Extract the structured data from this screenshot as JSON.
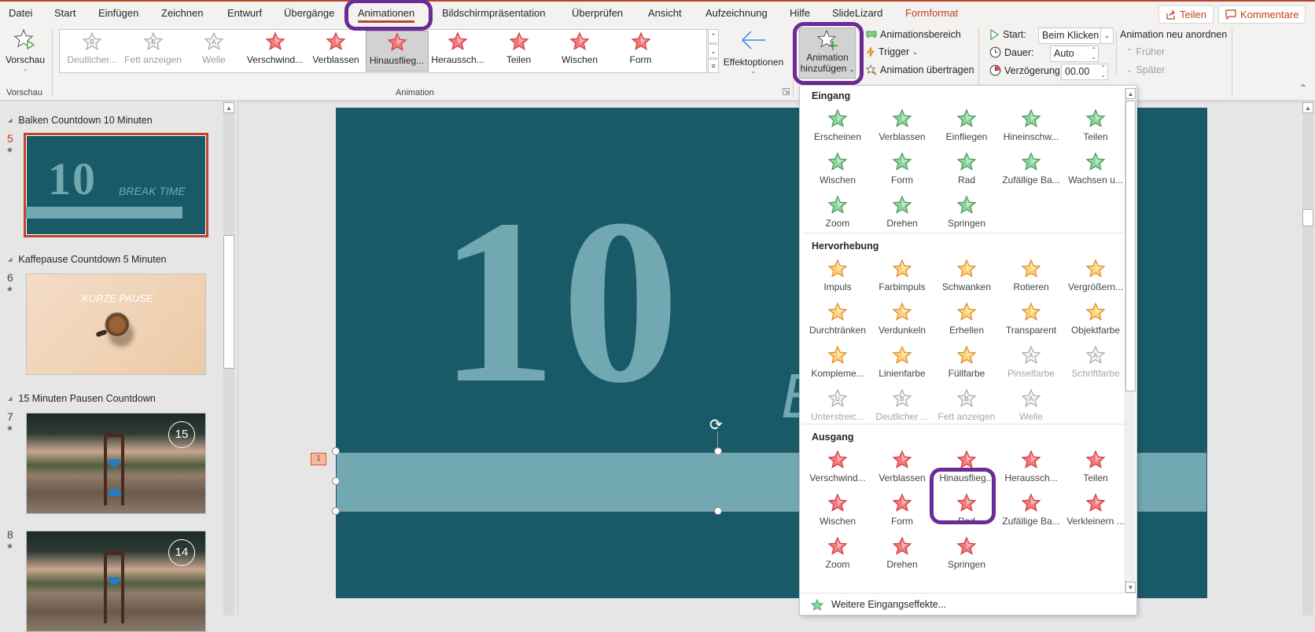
{
  "menu": {
    "tabs": [
      {
        "label": "Datei"
      },
      {
        "label": "Start"
      },
      {
        "label": "Einfügen"
      },
      {
        "label": "Zeichnen"
      },
      {
        "label": "Entwurf"
      },
      {
        "label": "Übergänge"
      },
      {
        "label": "Animationen",
        "active": true
      },
      {
        "label": "Bildschirmpräsentation"
      },
      {
        "label": "Überprüfen"
      },
      {
        "label": "Ansicht"
      },
      {
        "label": "Aufzeichnung"
      },
      {
        "label": "Hilfe"
      },
      {
        "label": "SlideLizard"
      },
      {
        "label": "Formformat",
        "contextual": true
      }
    ],
    "share_label": "Teilen",
    "comments_label": "Kommentare"
  },
  "ribbon": {
    "preview": {
      "button_label": "Vorschau",
      "group_label": "Vorschau"
    },
    "animation_group_label": "Animation",
    "gallery": [
      {
        "label": "Deutlicher...",
        "category": "emphasis",
        "disabled": true,
        "glyph": "B"
      },
      {
        "label": "Fett anzeigen",
        "category": "emphasis",
        "disabled": true,
        "glyph": "B"
      },
      {
        "label": "Welle",
        "category": "emphasis",
        "disabled": true,
        "glyph": "A"
      },
      {
        "label": "Verschwind...",
        "category": "exit"
      },
      {
        "label": "Verblassen",
        "category": "exit"
      },
      {
        "label": "Hinausflieg...",
        "category": "exit",
        "selected": true
      },
      {
        "label": "Heraussch...",
        "category": "exit"
      },
      {
        "label": "Teilen",
        "category": "exit"
      },
      {
        "label": "Wischen",
        "category": "exit"
      },
      {
        "label": "Form",
        "category": "exit"
      }
    ],
    "effect_options_label": "Effektoptionen",
    "add_animation": {
      "line1": "Animation",
      "line2": "hinzufügen"
    },
    "advanced": {
      "pane_label": "Animationsbereich",
      "trigger_label": "Trigger",
      "painter_label": "Animation übertragen"
    },
    "timing": {
      "start_label": "Start:",
      "start_value": "Beim Klicken",
      "duration_label": "Dauer:",
      "duration_value": "Auto",
      "delay_label": "Verzögerung:",
      "delay_value": "00.00"
    },
    "reorder": {
      "title": "Animation neu anordnen",
      "earlier_label": "Früher",
      "later_label": "Später"
    }
  },
  "thumbnails": {
    "sections": [
      {
        "title": "Balken Countdown 10 Minuten"
      },
      {
        "title": "Kaffepause Countdown 5 Minuten"
      },
      {
        "title": "15 Minuten Pausen Countdown"
      }
    ],
    "slides": [
      {
        "number": "5",
        "active": true,
        "big_text": "10",
        "caption": "BREAK TIME"
      },
      {
        "number": "6",
        "caption": "KURZE PAUSE"
      },
      {
        "number": "7",
        "badge": "15"
      },
      {
        "number": "8",
        "badge": "14"
      }
    ]
  },
  "slide": {
    "big_number": "10",
    "partial_text": "B",
    "animation_tag": "1",
    "colors": {
      "background": "#195a68",
      "accent": "#72a8b2"
    }
  },
  "dropdown": {
    "sections": [
      {
        "title": "Eingang",
        "color": "green",
        "items": [
          "Erscheinen",
          "Verblassen",
          "Einfliegen",
          "Hineinschw...",
          "Teilen",
          "Wischen",
          "Form",
          "Rad",
          "Zufällige Ba...",
          "Wachsen u...",
          "Zoom",
          "Drehen",
          "Springen"
        ]
      },
      {
        "title": "Hervorhebung",
        "color": "orange",
        "items": [
          "Impuls",
          "Farbimpuls",
          "Schwanken",
          "Rotieren",
          "Vergrößern...",
          "Durchtränken",
          "Verdunkeln",
          "Erhellen",
          "Transparent",
          "Objektfarbe",
          "Kompleme...",
          "Linienfarbe",
          "Füllfarbe",
          "Pinselfarbe",
          "Schriftfarbe",
          "Unterstreic...",
          "Deutlicher ...",
          "Fett anzeigen",
          "Welle"
        ],
        "disabled_from": 13
      },
      {
        "title": "Ausgang",
        "color": "red",
        "items": [
          "Verschwind...",
          "Verblassen",
          "Hinausflieg...",
          "Heraussch...",
          "Teilen",
          "Wischen",
          "Form",
          "Rad",
          "Zufällige Ba...",
          "Verkleinern ...",
          "Zoom",
          "Drehen",
          "Springen"
        ],
        "highlighted": "Hinausflieg..."
      }
    ],
    "footer_label": "Weitere Eingangseffekte..."
  },
  "colors": {
    "accent": "#b7472a",
    "highlight_ring": "#6b2a96",
    "entrance": "#5cb87a",
    "emphasis": "#f5b840",
    "exit": "#e84a4f"
  }
}
